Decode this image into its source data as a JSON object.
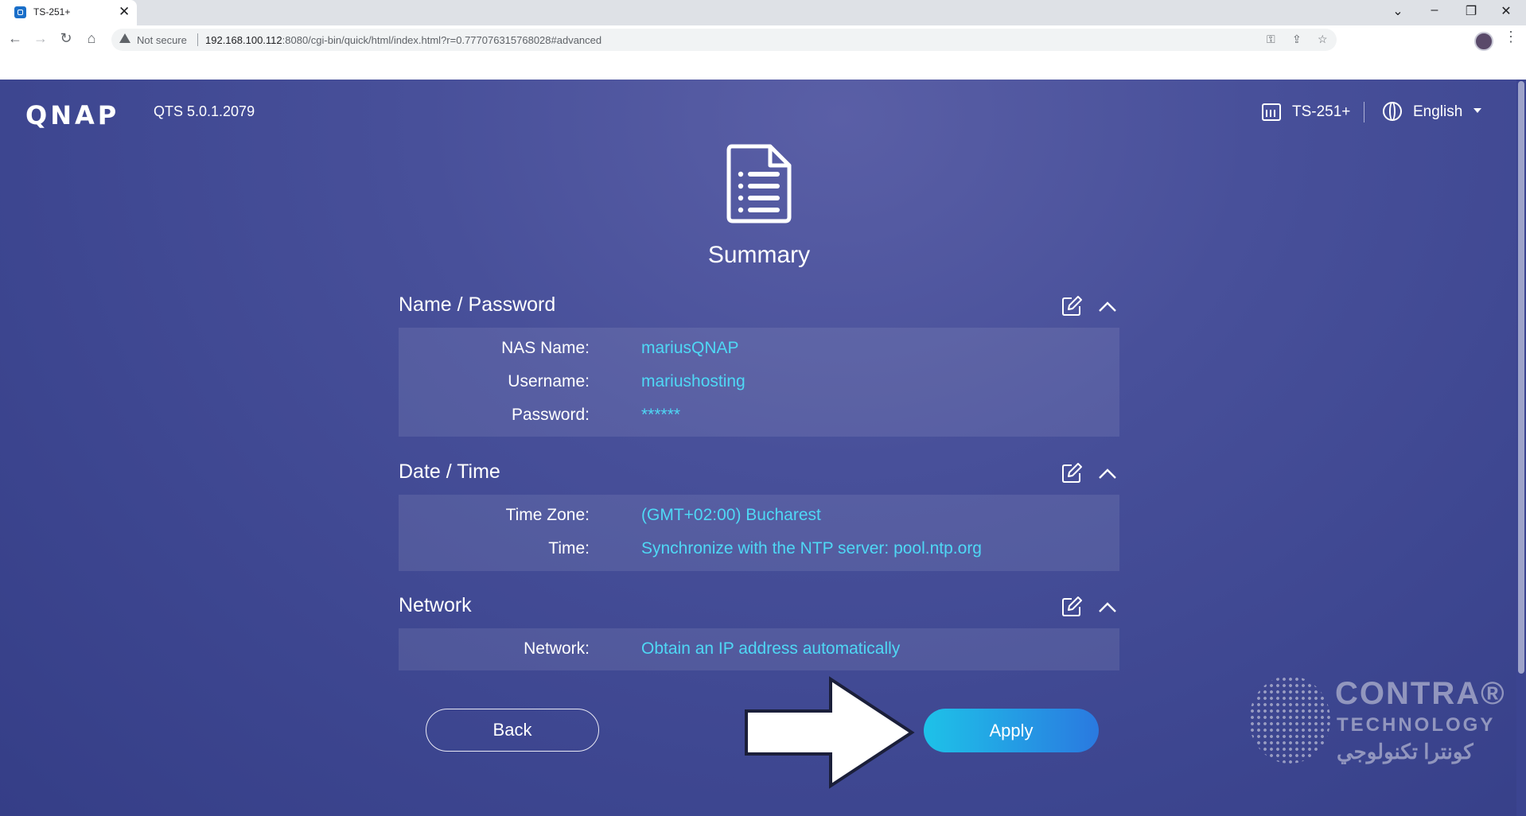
{
  "browser": {
    "tab_title": "TS-251+",
    "not_secure": "Not secure",
    "url_host": "192.168.100.112",
    "url_rest": ":8080/cgi-bin/quick/html/index.html?r=0.777076315768028#advanced"
  },
  "header": {
    "logo": "QNAP",
    "version": "QTS 5.0.1.2079",
    "device": "TS-251+",
    "language": "English"
  },
  "summary": {
    "title": "Summary",
    "sections": [
      {
        "title": "Name / Password",
        "rows": [
          {
            "label": "NAS Name:",
            "value": "mariusQNAP"
          },
          {
            "label": "Username:",
            "value": "mariushosting"
          },
          {
            "label": "Password:",
            "value": "******"
          }
        ]
      },
      {
        "title": "Date / Time",
        "rows": [
          {
            "label": "Time Zone:",
            "value": "(GMT+02:00) Bucharest"
          },
          {
            "label": "Time:",
            "value": "Synchronize with the NTP server: pool.ntp.org"
          }
        ]
      },
      {
        "title": "Network",
        "rows": [
          {
            "label": "Network:",
            "value": "Obtain an IP address automatically"
          }
        ]
      }
    ]
  },
  "buttons": {
    "back": "Back",
    "apply": "Apply"
  },
  "watermark": {
    "line1": "CONTRA®",
    "line2": "TECHNOLOGY",
    "line3": "كونترا تكنولوجي"
  },
  "colors": {
    "accent_value": "#4fd8f5",
    "apply_gradient_start": "#1ec2e8",
    "apply_gradient_end": "#2a79e0",
    "background": "#48509a"
  }
}
